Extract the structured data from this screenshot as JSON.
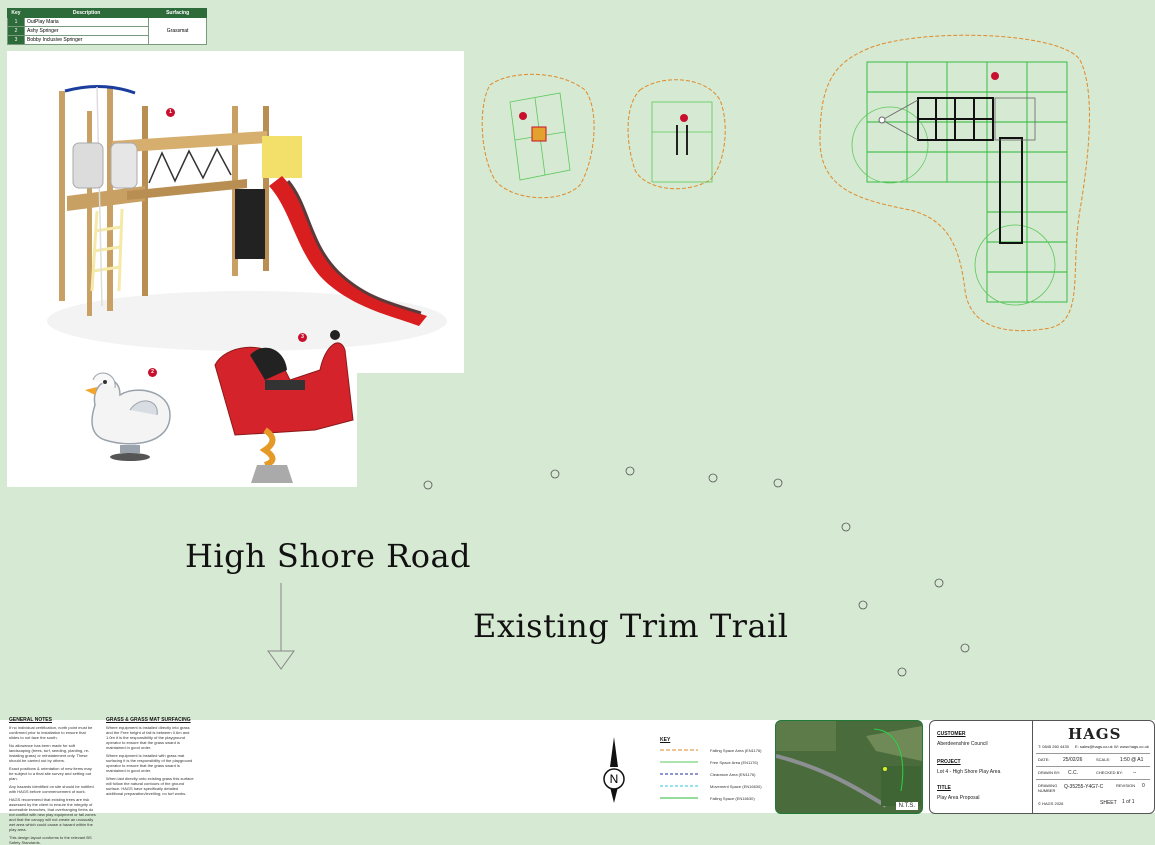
{
  "key_table": {
    "headers": [
      "Key",
      "Description",
      "Surfacing"
    ],
    "rows": [
      {
        "key": "1",
        "description": "OutPlay Maria"
      },
      {
        "key": "2",
        "description": "Ashy Springer"
      },
      {
        "key": "3",
        "description": "Bobby Inclusive Springer"
      }
    ],
    "surfacing": "Grassmat"
  },
  "badges": [
    "1",
    "2",
    "3"
  ],
  "labels": {
    "high_shore_road": "High Shore Road",
    "existing_trim_trail": "Existing Trim Trail"
  },
  "notes": {
    "general_heading": "GENERAL NOTES",
    "general_paragraphs": [
      "If no individual certification, north point must be confirmed prior to installation to ensure that slides to not face the south.",
      "No allowance has been made for soft landscaping (trees, turf, seeding, planting, re-instating grass) or reinstatement only. These should be carried out by others.",
      "Exact positions & orientation of new items may be subject to a final site survey and setting out plan.",
      "Any hazards identified on site should be notified with HAGS before commencement of work.",
      "HAGS recommend that existing trees are risk assessed by the client to ensure the integrity of accessible branches, that overhanging limbs do not conflict with new play equipment or fall zones and that the canopy will not create an unusually wet area which could cause a hazard within the play area.",
      "This design layout conforms to the relevant BS Safety Standards."
    ],
    "grass_heading": "GRASS & GRASS MAT SURFACING",
    "grass_paragraphs": [
      "Where equipment is installed directly into grass and the Free height of fall is between 0.6m and 1.0m it is the responsibility of the playground operator to ensure that the grass sward is maintained in good order.",
      "Where equipment is installed with grass mat surfacing it is the responsibility of the playground operator to ensure that the grass sward is maintained in good order.",
      "When laid directly onto existing grass this surface will follow the natural contours of the ground surface. HAGS have specifically detailed additional preparation/levelling; no turf works."
    ]
  },
  "north": "N",
  "legend": {
    "title": "KEY",
    "items": [
      {
        "label": "Falling Space Area (EN1176)",
        "color": "#e08a2a"
      },
      {
        "label": "Free Space Area (EN1176)",
        "color": "#5bc85b"
      },
      {
        "label": "Clearance Area (EN1176)",
        "color": "#1c2ea0"
      },
      {
        "label": "Movement Space (EN16630)",
        "color": "#35c6e0"
      },
      {
        "label": "Falling Space (EN16630)",
        "color": "#29b837"
      }
    ]
  },
  "location_map": {
    "scale": "N.T.S."
  },
  "title_block": {
    "brand": "HAGS",
    "phone": "T: 0845 260 4430",
    "email": "E: sales@hags.co.uk",
    "web": "W: www.hags.co.uk",
    "customer_label": "CUSTOMER",
    "customer": "Aberdeenshire Council",
    "project_label": "PROJECT",
    "project": "Lot 4 - High Shore Play Area",
    "title_label": "TITLE",
    "title": "Play Area Proposal",
    "date_label": "DATE:",
    "date": "25/02/26",
    "scale_label": "SCALE:",
    "scale": "1:50 @ A1",
    "drawn_label": "DRAWN BY:",
    "drawn": "C.C.",
    "checked_label": "CHECKED BY:",
    "checked": "--",
    "drawing_label": "DRAWING NUMBER",
    "drawing": "Q-35255-Y4G7-C",
    "revision_label": "REVISION",
    "revision": "0",
    "copyright": "© HAGS 2026",
    "sheet_label": "SHEET",
    "sheet": "1 of 1"
  }
}
